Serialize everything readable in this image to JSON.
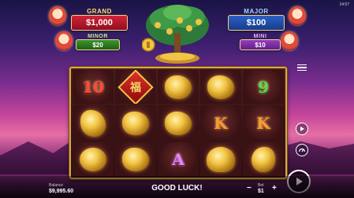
{
  "status": {
    "clock": "14:57"
  },
  "jackpots": {
    "grand": {
      "label": "GRAND",
      "value": "$1,000"
    },
    "minor": {
      "label": "MINOR",
      "value": "$20"
    },
    "major": {
      "label": "MAJOR",
      "value": "$100"
    },
    "mini": {
      "label": "MINI",
      "value": "$10"
    }
  },
  "reels": [
    [
      "10",
      "fu-symbol",
      "gold-pig",
      "gold-pig",
      "9"
    ],
    [
      "gold-rooster",
      "gold-pig",
      "gold-pig",
      "K",
      "K"
    ],
    [
      "gold-turtle",
      "gold-pig",
      "A",
      "gold-tiger",
      "gold-monkey"
    ]
  ],
  "fu_char": "福",
  "message": "GOOD LUCK!",
  "balance": {
    "label": "Balance",
    "value": "$9,995.60"
  },
  "bet": {
    "label": "Bet",
    "value": "$1",
    "minus": "−",
    "plus": "+"
  },
  "colors": {
    "frame": "#d8a94a",
    "grand": "#d8243a",
    "major": "#2d62c9",
    "minor": "#3c9a2e",
    "mini": "#9b3fc4"
  }
}
